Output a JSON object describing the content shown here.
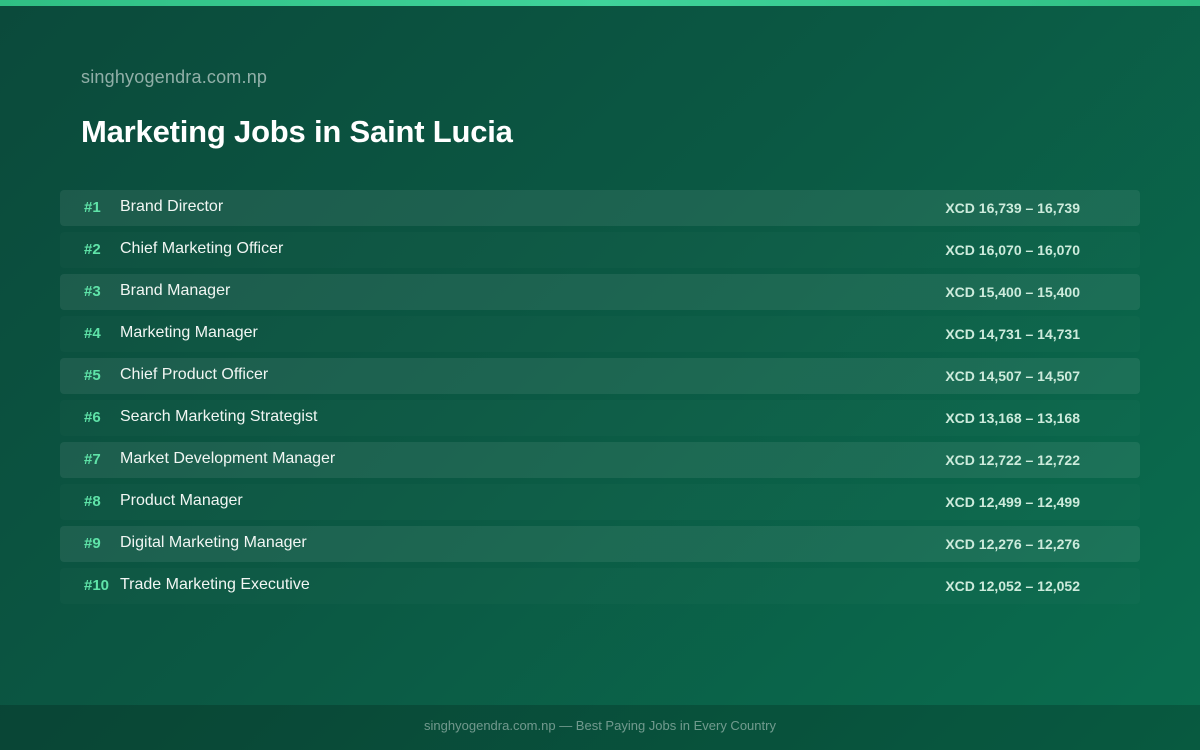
{
  "site": "singhyogendra.com.np",
  "title": "Marketing Jobs in Saint Lucia",
  "jobs": [
    {
      "rank": "#1",
      "title": "Brand Director",
      "salary": "XCD 16,739 – 16,739"
    },
    {
      "rank": "#2",
      "title": "Chief Marketing Officer",
      "salary": "XCD 16,070 – 16,070"
    },
    {
      "rank": "#3",
      "title": "Brand Manager",
      "salary": "XCD 15,400 – 15,400"
    },
    {
      "rank": "#4",
      "title": "Marketing Manager",
      "salary": "XCD 14,731 – 14,731"
    },
    {
      "rank": "#5",
      "title": "Chief Product Officer",
      "salary": "XCD 14,507 – 14,507"
    },
    {
      "rank": "#6",
      "title": "Search Marketing Strategist",
      "salary": "XCD 13,168 – 13,168"
    },
    {
      "rank": "#7",
      "title": "Market Development Manager",
      "salary": "XCD 12,722 – 12,722"
    },
    {
      "rank": "#8",
      "title": "Product Manager",
      "salary": "XCD 12,499 – 12,499"
    },
    {
      "rank": "#9",
      "title": "Digital Marketing Manager",
      "salary": "XCD 12,276 – 12,276"
    },
    {
      "rank": "#10",
      "title": "Trade Marketing Executive",
      "salary": "XCD 12,052 – 12,052"
    }
  ],
  "footer": "singhyogendra.com.np — Best Paying Jobs in Every Country",
  "colors": {
    "accent": "#5fe3a8",
    "background_start": "#0b4a3b",
    "background_end": "#0a6e4f",
    "top_bar": "#3fd39a"
  }
}
